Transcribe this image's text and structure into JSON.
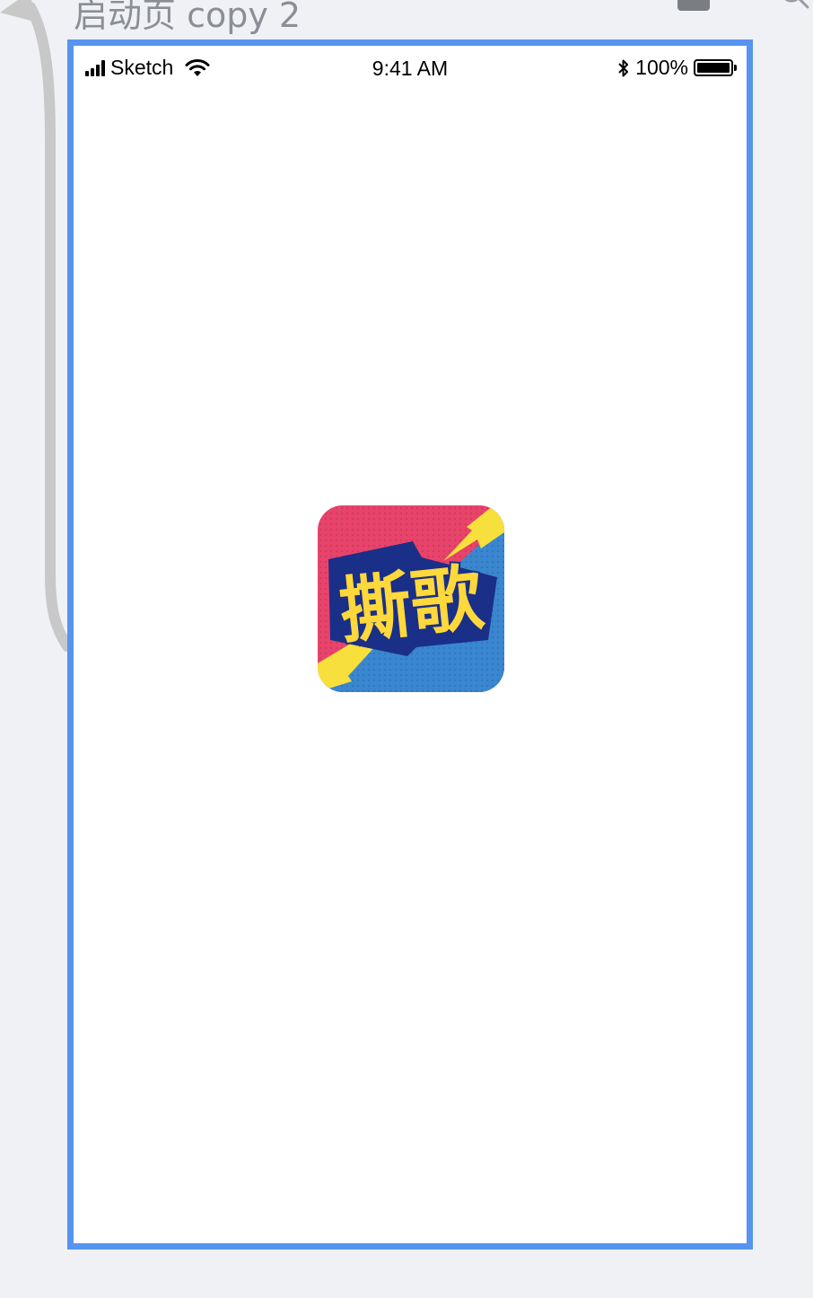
{
  "artboard": {
    "title": "启动页 copy 2"
  },
  "status_bar": {
    "carrier": "Sketch",
    "time": "9:41 AM",
    "battery_percent": "100%",
    "battery_level": 1.0
  },
  "splash": {
    "logo_text": "撕歌",
    "logo_colors": {
      "top_left": "#e8436b",
      "bottom_right": "#3a86d0",
      "bolt": "#f7e03c",
      "lettering": "#ffd83b",
      "outline": "#1a2f88"
    }
  },
  "icons": {
    "flow_arrow": "flow-arrow-icon",
    "toolbar": "toolbar-badge-icon",
    "search": "search-icon",
    "signal": "signal-icon",
    "wifi": "wifi-icon",
    "bluetooth": "bluetooth-icon",
    "battery": "battery-icon"
  },
  "colors": {
    "artboard_border": "#5694f0",
    "canvas_background": "#eff1f5"
  }
}
